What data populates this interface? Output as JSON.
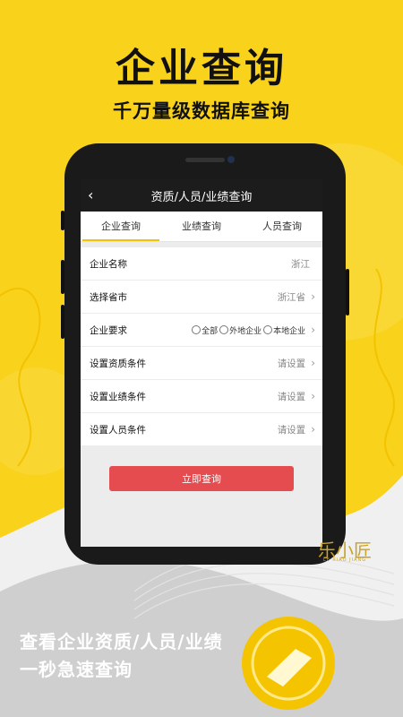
{
  "promo": {
    "headline": "企业查询",
    "subline": "千万量级数据库查询",
    "bottom_line1": "查看企业资质/人员/业绩",
    "bottom_line2": "一秒急速查询",
    "brand_logo": "乐小匠",
    "brand_sub": "LE XIAO JIANG"
  },
  "app": {
    "title": "资质/人员/业绩查询",
    "back_icon": "chevron-left-icon",
    "tabs": [
      {
        "label": "企业查询",
        "active": true
      },
      {
        "label": "业绩查询",
        "active": false
      },
      {
        "label": "人员查询",
        "active": false
      }
    ],
    "form": {
      "company_name": {
        "label": "企业名称",
        "value": "浙江"
      },
      "province": {
        "label": "选择省市",
        "value": "浙江省"
      },
      "requirement": {
        "label": "企业要求",
        "options": [
          "全部",
          "外地企业",
          "本地企业"
        ]
      },
      "qualification": {
        "label": "设置资质条件",
        "value": "请设置"
      },
      "performance": {
        "label": "设置业绩条件",
        "value": "请设置"
      },
      "personnel": {
        "label": "设置人员条件",
        "value": "请设置"
      }
    },
    "query_button": "立即查询"
  },
  "colors": {
    "background": "#f8d21b",
    "accent": "#f5c400",
    "button": "#e44c4f",
    "logo": "#c9a227"
  }
}
